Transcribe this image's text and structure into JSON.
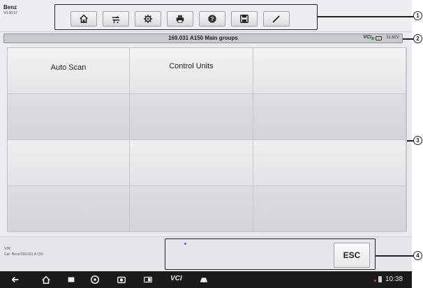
{
  "header": {
    "brand": "Benz",
    "version": "V0.90.57",
    "toolbar": [
      {
        "icon": "home-icon",
        "label": "Home"
      },
      {
        "icon": "vehicle-swap-icon",
        "label": "Vehicle Swap"
      },
      {
        "icon": "gear-icon",
        "label": "Settings"
      },
      {
        "icon": "printer-icon",
        "label": "Print"
      },
      {
        "icon": "help-icon",
        "label": "Help"
      },
      {
        "icon": "save-icon",
        "label": "Save"
      },
      {
        "icon": "pen-icon",
        "label": "Data Logging"
      }
    ]
  },
  "titlebar": {
    "title": "169.031 A150 Main groups",
    "vci": "VCI",
    "voltage": "11.62V"
  },
  "grid": {
    "rows": 4,
    "cols": 3,
    "items": [
      "Auto Scan",
      "Control Units"
    ]
  },
  "footer": {
    "vin_label": "VIN:",
    "car_info": "Car: Benz/169.031 A 150",
    "esc_label": "ESC"
  },
  "navbar": {
    "vci_label": "VCI",
    "time": "10:38"
  },
  "callouts": [
    "1",
    "2",
    "3",
    "4"
  ],
  "colors": {
    "toolbar_bg": "#eceef1",
    "titlebar_bg": "#c6c9cd",
    "grid_bg": "#d7d9dc",
    "nav_bg": "#1a1a1a",
    "vci_connected": "#4aa14a"
  }
}
